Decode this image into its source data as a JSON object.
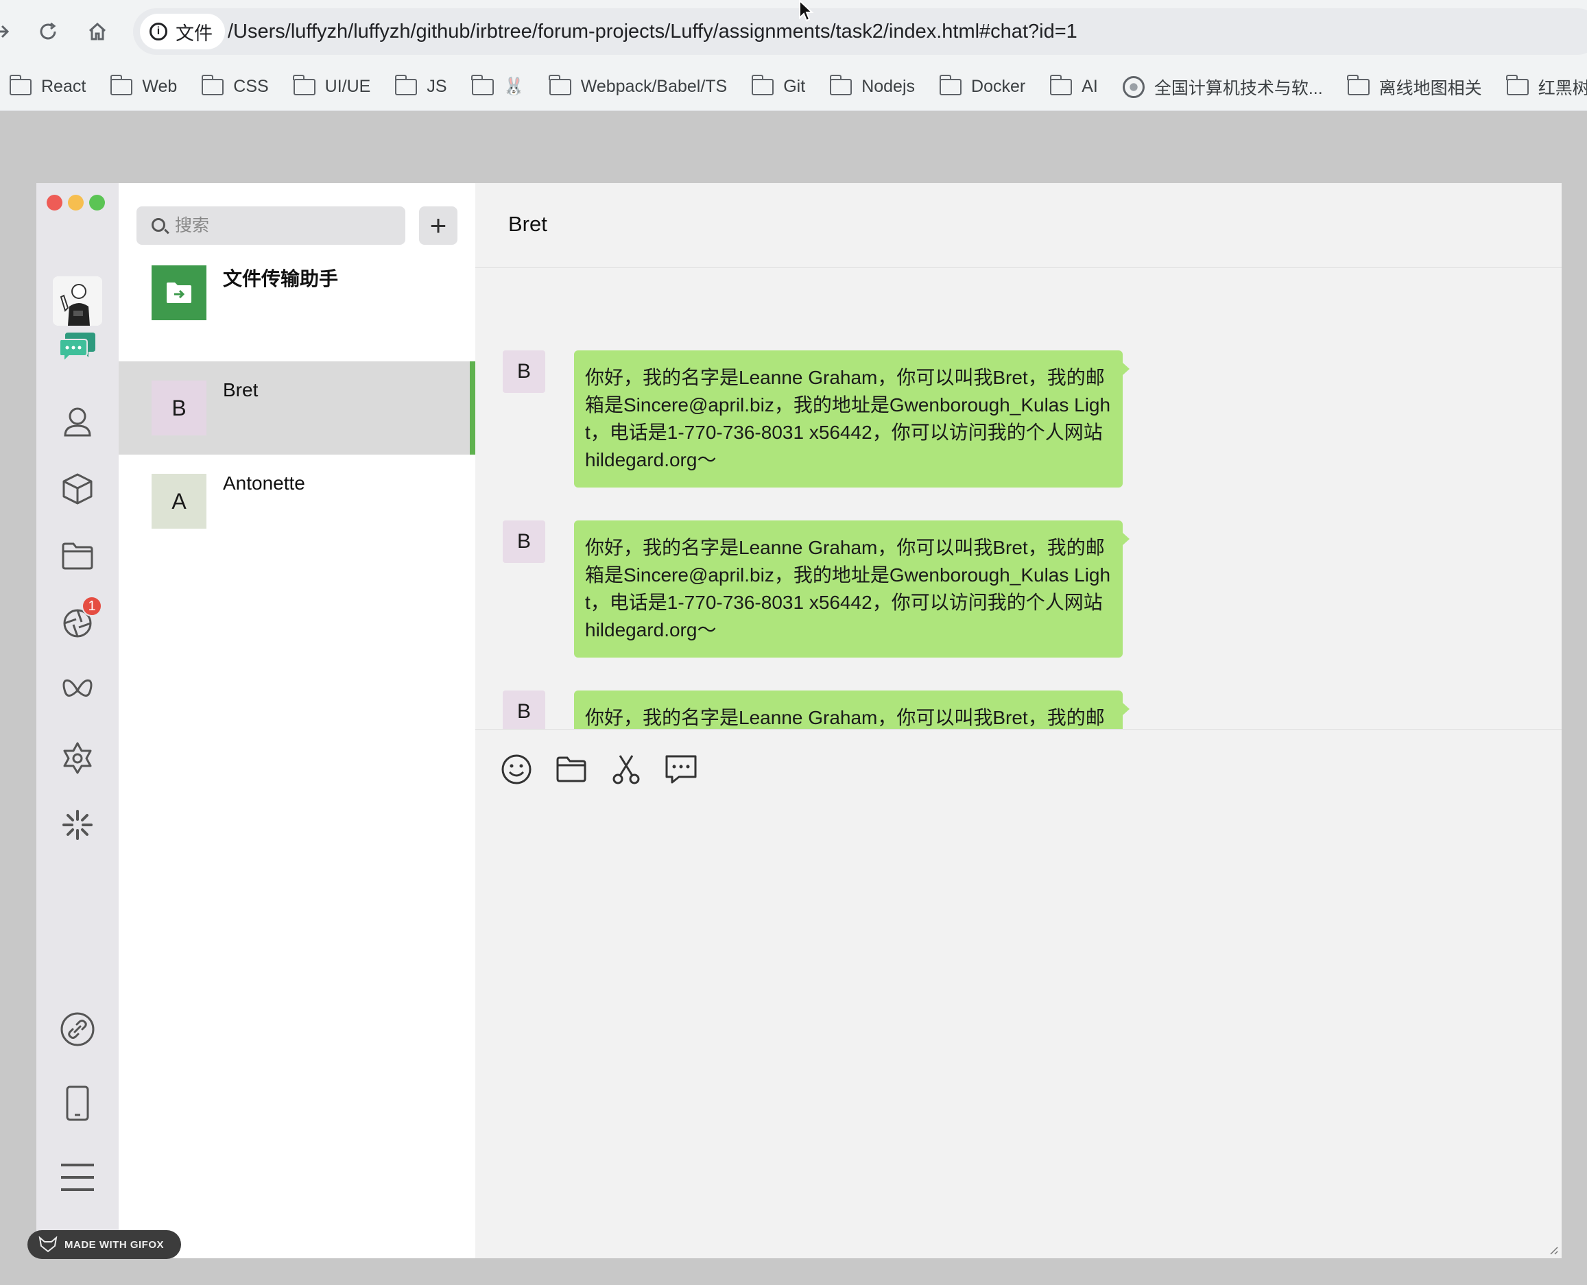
{
  "browser": {
    "site_chip": "文件",
    "url": "/Users/luffyzh/luffyzh/github/irbtree/forum-projects/Luffy/assignments/task2/index.html#chat?id=1",
    "bookmarks": [
      "React",
      "Web",
      "CSS",
      "UI/UE",
      "JS",
      "🐰",
      "Webpack/Babel/TS",
      "Git",
      "Nodejs",
      "Docker",
      "AI",
      "全国计算机技术与软...",
      "离线地图相关",
      "红黑树"
    ]
  },
  "colors": {
    "accent": "#5fb24f",
    "bubble": "#aee57c",
    "badge": "#e54d42",
    "file_helper": "#3e9a4c"
  },
  "rail": {
    "badge_count": "1",
    "icons": [
      "chat-icon",
      "contacts-icon",
      "cube-icon",
      "folder-icon",
      "moments-icon",
      "butterfly-icon",
      "star-icon",
      "sparkle-icon",
      "link-icon",
      "phone-icon",
      "menu-icon"
    ]
  },
  "search": {
    "placeholder": "搜索",
    "add_label": "+"
  },
  "chats": [
    {
      "name": "文件传输助手",
      "avatar": ""
    },
    {
      "name": "Bret",
      "avatar": "B"
    },
    {
      "name": "Antonette",
      "avatar": "A"
    }
  ],
  "conversation": {
    "title": "Bret",
    "messages": [
      {
        "avatar": "B",
        "text": "你好，我的名字是Leanne Graham，你可以叫我Bret，我的邮箱是Sincere@april.biz，我的地址是Gwenborough_Kulas Light，电话是1-770-736-8031 x56442，你可以访问我的个人网站hildegard.org～"
      },
      {
        "avatar": "B",
        "text": "你好，我的名字是Leanne Graham，你可以叫我Bret，我的邮箱是Sincere@april.biz，我的地址是Gwenborough_Kulas Light，电话是1-770-736-8031 x56442，你可以访问我的个人网站hildegard.org～"
      },
      {
        "avatar": "B",
        "text": "你好，我的名字是Leanne Graham，你可以叫我Bret，我的邮箱是Sincere@april.biz，我的地址是Gwenborough_Kulas Light，电话是1-770-736-8031 x56442，你可以访问我的个人网站hildegard.org～"
      }
    ]
  },
  "composer": {
    "tools": [
      "emoji-icon",
      "folder-icon",
      "scissors-icon",
      "chat-history-icon"
    ]
  },
  "watermark": "MADE WITH GIFOX"
}
